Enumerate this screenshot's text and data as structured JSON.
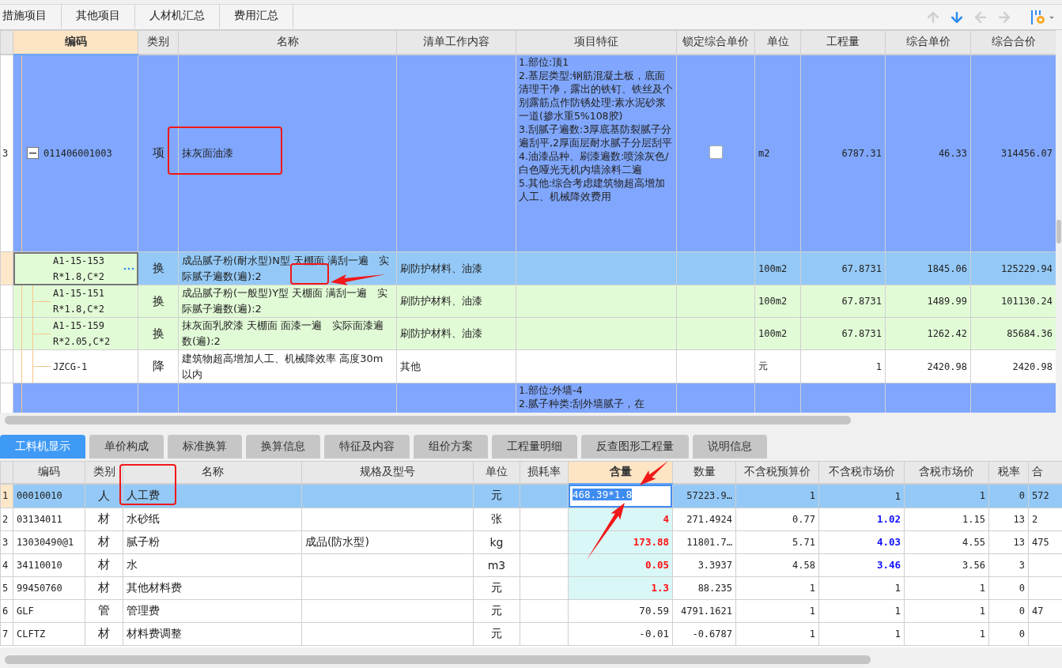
{
  "top_tabs": [
    {
      "label": "措施项目",
      "selected": false
    },
    {
      "label": "其他项目",
      "selected": false
    },
    {
      "label": "人材机汇总",
      "selected": false
    },
    {
      "label": "费用汇总",
      "selected": false
    }
  ],
  "toolbar": [
    {
      "kind": "up",
      "disabled": true
    },
    {
      "kind": "down",
      "disabled": false
    },
    {
      "kind": "left",
      "disabled": true
    },
    {
      "kind": "right",
      "disabled": true
    },
    {
      "kind": "columns",
      "disabled": false
    }
  ],
  "upper_table": {
    "columns": [
      {
        "label": "编码",
        "selected": true
      },
      {
        "label": "类别",
        "selected": false
      },
      {
        "label": "名称",
        "selected": false
      },
      {
        "label": "清单工作内容",
        "selected": false
      },
      {
        "label": "项目特征",
        "selected": false
      },
      {
        "label": "锁定综合单价",
        "selected": false
      },
      {
        "label": "单位",
        "selected": false
      },
      {
        "label": "工程量",
        "selected": false
      },
      {
        "label": "综合单价",
        "selected": false
      },
      {
        "label": "综合合价",
        "selected": false
      }
    ],
    "rows": [
      {
        "kind": "bill",
        "selected": false,
        "row_number": "3",
        "expanded": true,
        "code": "011406001003",
        "type": "项",
        "name": "抹灰面油漆",
        "features": "1.部位:顶1\n2.基层类型:钢筋混凝土板，底面清理干净，露出的铁钉、铁丝及个别露筋点作防锈处理:素水泥砂浆一道(掺水重5%108胶)\n3.刮腻子遍数:3厚底基防裂腻子分遍刮平,2厚面层耐水腻子分层刮平\n4.油漆品种、刷漆遍数:喷涂灰色/白色哑光无机内墙涂料二遍\n5.其他:综合考虑建筑物超高增加人工、机械降效费用",
        "lock_checked": false,
        "unit": "m2",
        "quantity": "6787.31",
        "unit_price": "46.33",
        "total": "314456.07"
      },
      {
        "kind": "quota",
        "selected": true,
        "code": "A1-15-153\nR*1.8,C*2",
        "type": "换",
        "name": "成品腻子粉(耐水型)N型 天棚面 满刮一遍　实际腻子遍数(遍):2",
        "work": "刷防护材料、油漆",
        "unit": "100m2",
        "quantity": "67.8731",
        "unit_price": "1845.06",
        "total": "125229.94"
      },
      {
        "kind": "quota",
        "selected": false,
        "code": "A1-15-151\nR*1.8,C*2",
        "type": "换",
        "name": "成品腻子粉(一般型)Y型 天棚面 满刮一遍　实际腻子遍数(遍):2",
        "work": "刷防护材料、油漆",
        "unit": "100m2",
        "quantity": "67.8731",
        "unit_price": "1489.99",
        "total": "101130.24"
      },
      {
        "kind": "quota",
        "selected": false,
        "code": "A1-15-159\nR*2.05,C*2",
        "type": "换",
        "name": "抹灰面乳胶漆 天棚面 面漆一遍　实际面漆遍数(遍):2",
        "work": "刷防护材料、油漆",
        "unit": "100m2",
        "quantity": "67.8731",
        "unit_price": "1262.42",
        "total": "85684.36"
      },
      {
        "kind": "fee",
        "selected": false,
        "code": "JZCG-1",
        "type": "降",
        "name": "建筑物超高增加人工、机械降效率 高度30m以内",
        "work": "其他",
        "unit": "元",
        "quantity": "1",
        "unit_price": "2420.98",
        "total": "2420.98"
      },
      {
        "kind": "bill",
        "selected": false,
        "features": "1.部位:外墙-4\n2.腻子种类:刮外墙腻子，在"
      }
    ]
  },
  "lower_tabs": [
    {
      "label": "工料机显示",
      "selected": true
    },
    {
      "label": "单价构成",
      "selected": false
    },
    {
      "label": "标准换算",
      "selected": false
    },
    {
      "label": "换算信息",
      "selected": false
    },
    {
      "label": "特征及内容",
      "selected": false
    },
    {
      "label": "组价方案",
      "selected": false
    },
    {
      "label": "工程量明细",
      "selected": false
    },
    {
      "label": "反查图形工程量",
      "selected": false
    },
    {
      "label": "说明信息",
      "selected": false
    }
  ],
  "lower_table": {
    "columns": [
      {
        "label": "编码",
        "selected": false
      },
      {
        "label": "类别",
        "selected": false
      },
      {
        "label": "名称",
        "selected": false
      },
      {
        "label": "规格及型号",
        "selected": false
      },
      {
        "label": "单位",
        "selected": false
      },
      {
        "label": "损耗率",
        "selected": false
      },
      {
        "label": "含量",
        "selected": true
      },
      {
        "label": "数量",
        "selected": false
      },
      {
        "label": "不含税预算价",
        "selected": false
      },
      {
        "label": "不含税市场价",
        "selected": false
      },
      {
        "label": "含税市场价",
        "selected": false
      },
      {
        "label": "税率",
        "selected": false
      },
      {
        "label": "合",
        "selected": false
      }
    ],
    "rows": [
      {
        "row_number": "1",
        "selected": true,
        "editing": true,
        "content_modified": false,
        "market_modified": false,
        "code": "00010010",
        "type": "人",
        "name": "人工费",
        "unit": "元",
        "content": "468.39*1.8",
        "quantity": "57223.9…",
        "budget_price": "1",
        "market_price": "1",
        "tax_market_price": "1",
        "tax_rate": "0",
        "column_13": "572"
      },
      {
        "row_number": "2",
        "selected": false,
        "editing": false,
        "content_modified": true,
        "market_modified": true,
        "code": "03134011",
        "type": "材",
        "name": "水砂纸",
        "unit": "张",
        "content": "4",
        "quantity": "271.4924",
        "budget_price": "0.77",
        "market_price": "1.02",
        "tax_market_price": "1.15",
        "tax_rate": "13",
        "column_13": "2"
      },
      {
        "row_number": "3",
        "selected": false,
        "editing": false,
        "content_modified": true,
        "market_modified": true,
        "code": "13030490@1",
        "type": "材",
        "name": "腻子粉",
        "spec": "成品(防水型)",
        "unit": "kg",
        "content": "173.88",
        "quantity": "11801.7…",
        "budget_price": "5.71",
        "market_price": "4.03",
        "tax_market_price": "4.55",
        "tax_rate": "13",
        "column_13": "475"
      },
      {
        "row_number": "4",
        "selected": false,
        "editing": false,
        "content_modified": true,
        "market_modified": true,
        "code": "34110010",
        "type": "材",
        "name": "水",
        "unit": "m3",
        "content": "0.05",
        "quantity": "3.3937",
        "budget_price": "4.58",
        "market_price": "3.46",
        "tax_market_price": "3.56",
        "tax_rate": "3"
      },
      {
        "row_number": "5",
        "selected": false,
        "editing": false,
        "content_modified": true,
        "market_modified": false,
        "code": "99450760",
        "type": "材",
        "name": "其他材料费",
        "unit": "元",
        "content": "1.3",
        "quantity": "88.235",
        "budget_price": "1",
        "market_price": "1",
        "tax_market_price": "1",
        "tax_rate": "0"
      },
      {
        "row_number": "6",
        "selected": false,
        "editing": false,
        "content_modified": false,
        "market_modified": false,
        "code": "GLF",
        "type": "管",
        "name": "管理费",
        "unit": "元",
        "content": "70.59",
        "quantity": "4791.1621",
        "budget_price": "1",
        "market_price": "1",
        "tax_market_price": "1",
        "tax_rate": "0",
        "column_13": "47"
      },
      {
        "row_number": "7",
        "selected": false,
        "editing": false,
        "content_modified": false,
        "market_modified": false,
        "code": "CLFTZ",
        "type": "材",
        "name": "材料费调整",
        "unit": "元",
        "content": "-0.01",
        "quantity": "-0.6787",
        "budget_price": "1",
        "market_price": "1",
        "tax_market_price": "1",
        "tax_rate": "0"
      }
    ]
  }
}
